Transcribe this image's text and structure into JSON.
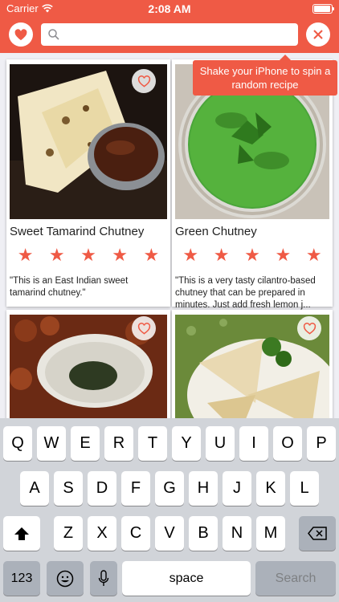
{
  "status_bar": {
    "carrier": "Carrier",
    "time": "2:08 AM"
  },
  "header": {
    "search": {
      "value": "",
      "placeholder": ""
    }
  },
  "tooltip": {
    "line1": "Shake your iPhone to spin a",
    "line2": "random recipe"
  },
  "cards": [
    {
      "title": "Sweet Tamarind Chutney",
      "rating": 5,
      "description": "\"This is an East Indian sweet tamarind chutney.\""
    },
    {
      "title": "Green Chutney",
      "rating": 5,
      "description": "\"This is a very tasty cilantro-based chutney that can be prepared in minutes. Just add fresh lemon j..."
    },
    {
      "title": "",
      "rating": 0,
      "description": ""
    },
    {
      "title": "",
      "rating": 0,
      "description": ""
    }
  ],
  "keyboard": {
    "row1": [
      "Q",
      "W",
      "E",
      "R",
      "T",
      "Y",
      "U",
      "I",
      "O",
      "P"
    ],
    "row2": [
      "A",
      "S",
      "D",
      "F",
      "G",
      "H",
      "J",
      "K",
      "L"
    ],
    "row3": [
      "Z",
      "X",
      "C",
      "V",
      "B",
      "N",
      "M"
    ],
    "numbers_label": "123",
    "space_label": "space",
    "search_label": "Search"
  },
  "colors": {
    "accent": "#ef5a45",
    "keyboard_bg": "#d1d4d9"
  },
  "icons": [
    "wifi-icon",
    "heart-icon",
    "search-icon",
    "close-icon",
    "star-icon",
    "shift-icon",
    "backspace-icon",
    "emoji-icon",
    "microphone-icon"
  ]
}
